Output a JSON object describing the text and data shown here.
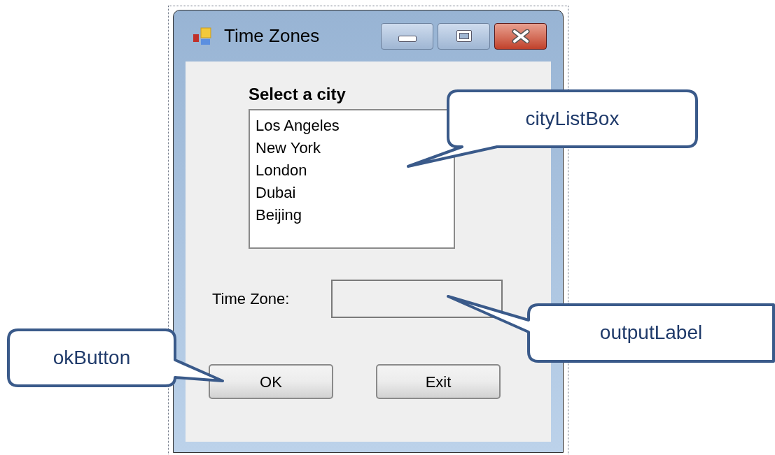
{
  "window": {
    "title": "Time Zones"
  },
  "heading": "Select a city",
  "city_list": [
    "Los Angeles",
    "New York",
    "London",
    "Dubai",
    "Beijing"
  ],
  "time_zone_label": "Time Zone:",
  "buttons": [
    "OK",
    "Exit"
  ],
  "callouts": [
    {
      "kind": "list",
      "text": "cityListBox"
    },
    {
      "kind": "output",
      "text": "outputLabel"
    },
    {
      "kind": "button",
      "text": "okButton"
    }
  ]
}
